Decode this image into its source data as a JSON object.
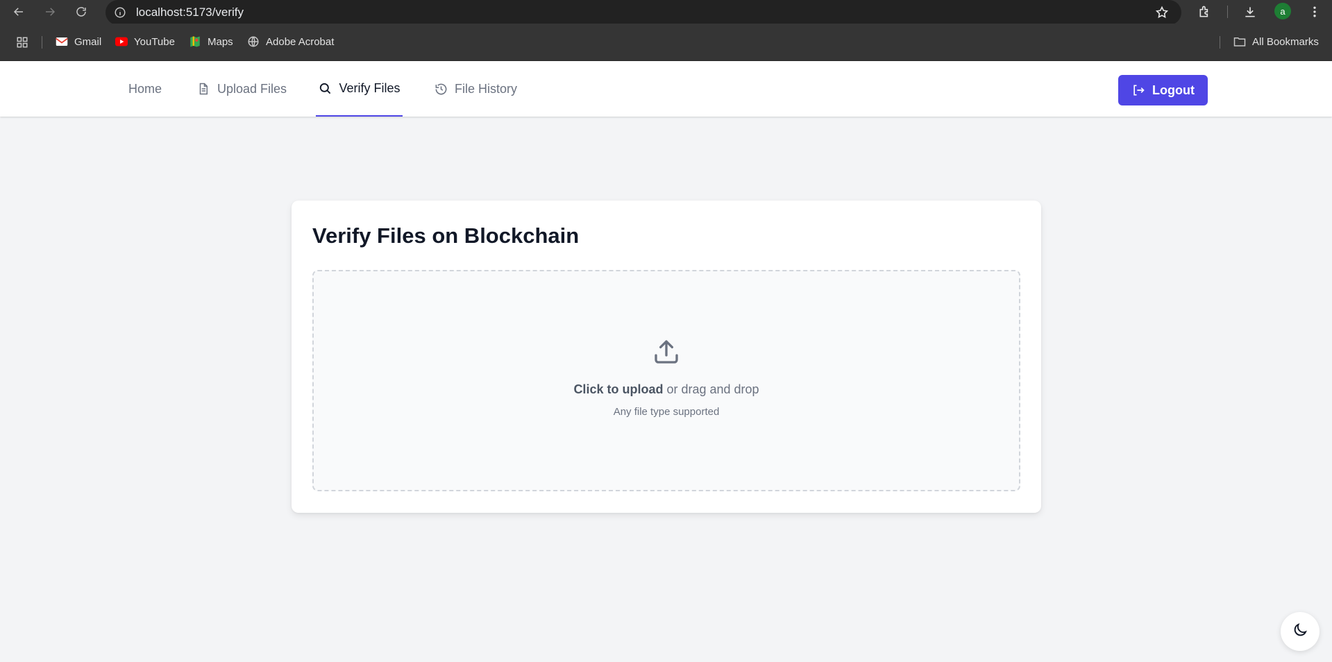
{
  "browser": {
    "url": "localhost:5173/verify",
    "avatar_letter": "a",
    "bookmarks": [
      {
        "label": "Gmail",
        "icon": "gmail-icon"
      },
      {
        "label": "YouTube",
        "icon": "youtube-icon"
      },
      {
        "label": "Maps",
        "icon": "maps-icon"
      },
      {
        "label": "Adobe Acrobat",
        "icon": "globe-icon"
      }
    ],
    "all_bookmarks_label": "All Bookmarks"
  },
  "nav": {
    "home": "Home",
    "upload": "Upload Files",
    "verify": "Verify Files",
    "history": "File History",
    "logout": "Logout",
    "active_tab": "verify",
    "accent_color": "#4f46e5"
  },
  "card": {
    "title": "Verify Files on Blockchain",
    "dropzone": {
      "click_text": "Click to upload",
      "drag_text": " or drag and drop",
      "subtext": "Any file type supported"
    }
  }
}
